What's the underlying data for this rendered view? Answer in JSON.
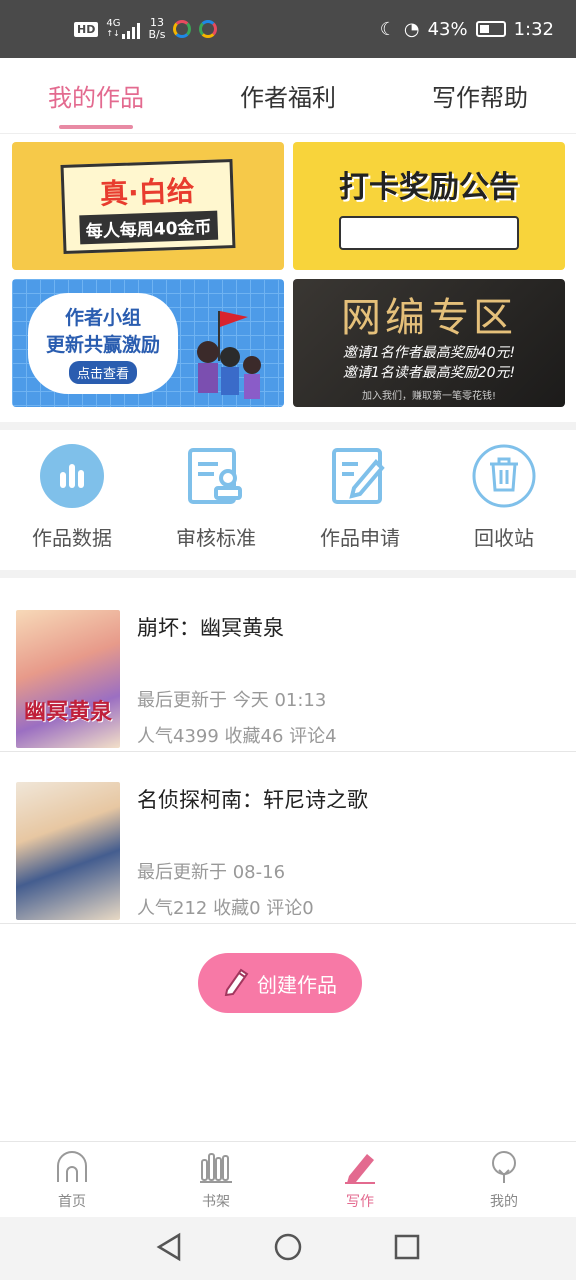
{
  "status_bar": {
    "hd": "HD",
    "network": "4G",
    "net_rate_value": "13",
    "net_rate_unit": "B/s",
    "battery": "43%",
    "battery_level": 0.43,
    "time": "1:32"
  },
  "tabs": [
    {
      "label": "我的作品",
      "active": true
    },
    {
      "label": "作者福利",
      "active": false
    },
    {
      "label": "写作帮助",
      "active": false
    }
  ],
  "banners": {
    "b1": {
      "title": "真·白给",
      "subtitle": "每人每周40金币"
    },
    "b2": {
      "title": "打卡奖励公告"
    },
    "b3": {
      "line1": "作者小组",
      "line2": "更新共赢激励",
      "button": "点击查看"
    },
    "b4": {
      "title": "网编专区",
      "line1": "邀请1名作者最高奖励40元!",
      "line2": "邀请1名读者最高奖励20元!",
      "line3": "加入我们，赚取第一笔零花钱!"
    }
  },
  "quick_actions": [
    {
      "label": "作品数据",
      "icon": "bar-chart-icon"
    },
    {
      "label": "审核标准",
      "icon": "stamp-document-icon"
    },
    {
      "label": "作品申请",
      "icon": "edit-document-icon"
    },
    {
      "label": "回收站",
      "icon": "trash-icon"
    }
  ],
  "works": [
    {
      "title": "崩坏：幽冥黄泉",
      "cover_text": "幽冥黄泉",
      "updated": "最后更新于 今天 01:13",
      "stats": "人气4399 收藏46 评论4"
    },
    {
      "title": "名侦探柯南：轩尼诗之歌",
      "cover_text": "",
      "updated": "最后更新于 08-16",
      "stats": "人气212 收藏0 评论0"
    }
  ],
  "create_button": "创建作品",
  "bottom_nav": [
    {
      "label": "首页",
      "icon": "home-icon",
      "active": false
    },
    {
      "label": "书架",
      "icon": "bookshelf-icon",
      "active": false
    },
    {
      "label": "写作",
      "icon": "pencil-icon",
      "active": true
    },
    {
      "label": "我的",
      "icon": "profile-icon",
      "active": false
    }
  ],
  "colors": {
    "accent": "#e36a8f",
    "create_button": "#f779a6",
    "icon_blue": "#7fc0ea"
  }
}
